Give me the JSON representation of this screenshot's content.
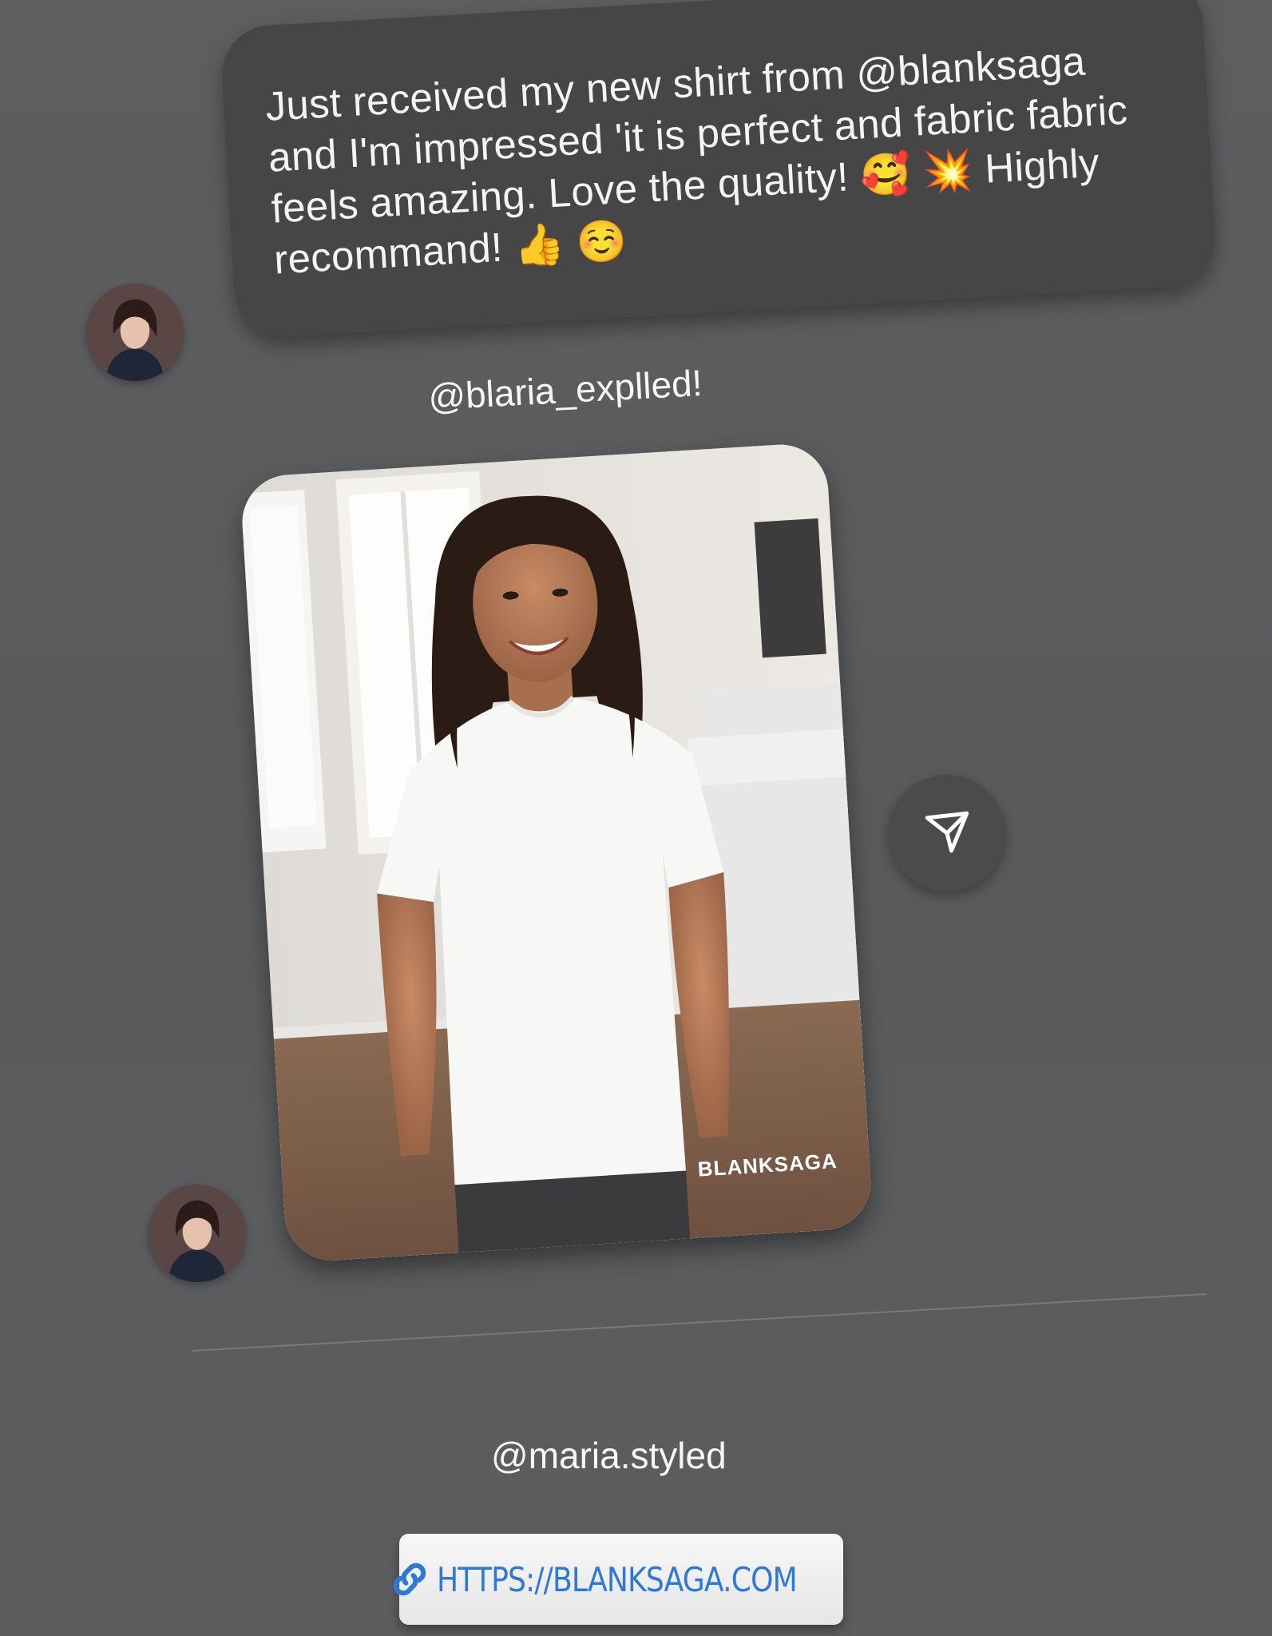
{
  "message": {
    "text": "Just received my new shirt from @blanksaga and I'm impressed 'it is perfect and fabric fabric feels amazing. Love the quality! 🥰 💥 Highly recommand! 👍 ☺️"
  },
  "post": {
    "handle_top": "@blaria_explled!",
    "watermark": "BLANKSAGA",
    "handle_bottom": "@maria.styled"
  },
  "link": {
    "url_label": "HTTPS://BLANKSAGA.COM"
  },
  "icons": {
    "share": "send-arrow-icon",
    "link": "chain-link-icon"
  },
  "colors": {
    "background": "#5c5d5e",
    "bubble": "#464646",
    "link_text": "#2e78d6"
  }
}
